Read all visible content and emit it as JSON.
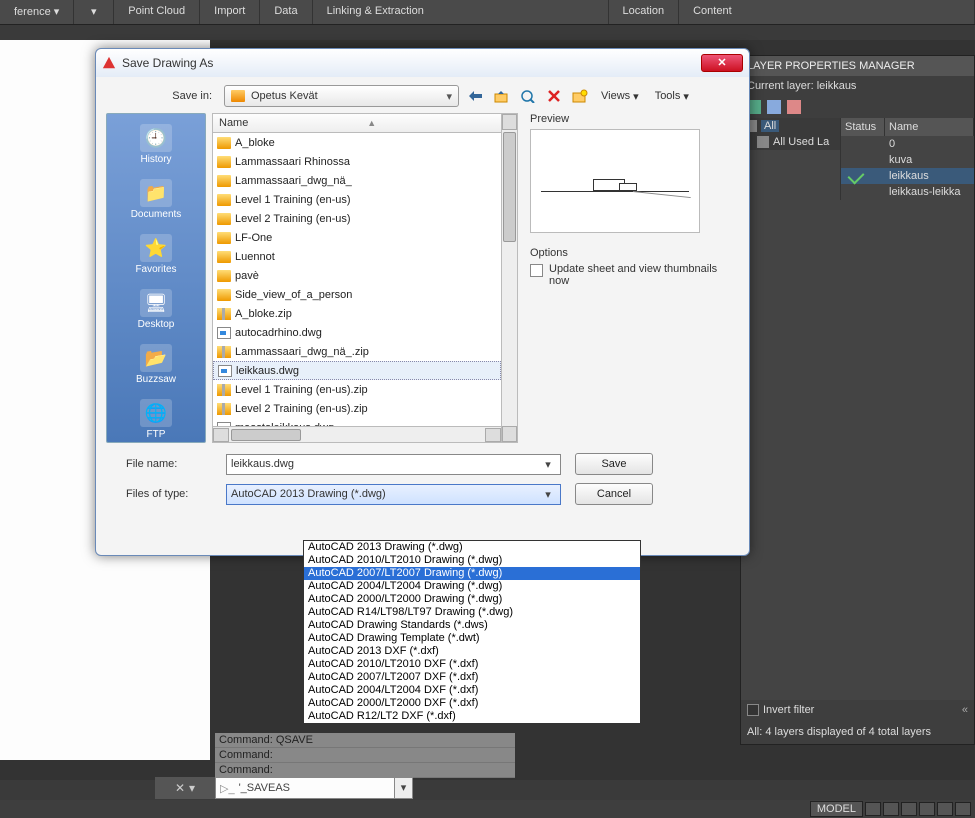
{
  "ribbon": {
    "tabs": [
      "ference ▾",
      "▾",
      "Point Cloud",
      "Import",
      "Data",
      "Linking & Extraction",
      "Location",
      "Content"
    ]
  },
  "layer_panel": {
    "title": "LAYER PROPERTIES MANAGER",
    "current": "Current layer: leikkaus",
    "columns": {
      "status": "Status",
      "name": "Name"
    },
    "filter_all": "All",
    "filter_allused": "All Used La",
    "rows": [
      {
        "name": "0",
        "current": false
      },
      {
        "name": "kuva",
        "current": false
      },
      {
        "name": "leikkaus",
        "current": true
      },
      {
        "name": "leikkaus-leikka",
        "current": false
      }
    ],
    "invert": "Invert filter",
    "status": "All: 4 layers displayed of 4 total layers"
  },
  "command": {
    "hist": [
      "Command:   QSAVE",
      "Command:",
      "Command:"
    ],
    "input": "'_SAVEAS"
  },
  "statusbar": {
    "model": "MODEL"
  },
  "dialog": {
    "title": "Save Drawing As",
    "savein_label": "Save in:",
    "savein_value": "Opetus Kevät",
    "views": "Views",
    "tools": "Tools",
    "places": [
      "History",
      "Documents",
      "Favorites",
      "Desktop",
      "Buzzsaw",
      "FTP"
    ],
    "list_header": "Name",
    "files": [
      {
        "n": "A_bloke",
        "t": "fold"
      },
      {
        "n": "Lammassaari Rhinossa",
        "t": "fold"
      },
      {
        "n": "Lammassaari_dwg_nä_",
        "t": "fold"
      },
      {
        "n": "Level 1 Training (en-us)",
        "t": "fold"
      },
      {
        "n": "Level 2 Training (en-us)",
        "t": "fold"
      },
      {
        "n": "LF-One",
        "t": "fold"
      },
      {
        "n": "Luennot",
        "t": "fold"
      },
      {
        "n": "pavè",
        "t": "fold"
      },
      {
        "n": "Side_view_of_a_person",
        "t": "fold"
      },
      {
        "n": "A_bloke.zip",
        "t": "zip"
      },
      {
        "n": "autocadrhino.dwg",
        "t": "dwg"
      },
      {
        "n": "Lammassaari_dwg_nä_.zip",
        "t": "zip"
      },
      {
        "n": "leikkaus.dwg",
        "t": "dwg",
        "sel": true
      },
      {
        "n": "Level 1 Training (en-us).zip",
        "t": "zip"
      },
      {
        "n": "Level 2 Training (en-us).zip",
        "t": "zip"
      },
      {
        "n": "maastoleikkaus.dwg",
        "t": "dwg"
      }
    ],
    "preview": "Preview",
    "options": "Options",
    "opt_update": "Update sheet and view thumbnails now",
    "filename_label": "File name:",
    "filename": "leikkaus.dwg",
    "filetype_label": "Files of type:",
    "filetype": "AutoCAD 2013 Drawing (*.dwg)",
    "save": "Save",
    "cancel": "Cancel",
    "type_options": [
      "AutoCAD 2013 Drawing (*.dwg)",
      "AutoCAD 2010/LT2010 Drawing (*.dwg)",
      "AutoCAD 2007/LT2007 Drawing (*.dwg)",
      "AutoCAD 2004/LT2004 Drawing (*.dwg)",
      "AutoCAD 2000/LT2000 Drawing (*.dwg)",
      "AutoCAD R14/LT98/LT97 Drawing (*.dwg)",
      "AutoCAD Drawing Standards (*.dws)",
      "AutoCAD Drawing Template (*.dwt)",
      "AutoCAD 2013 DXF (*.dxf)",
      "AutoCAD 2010/LT2010 DXF (*.dxf)",
      "AutoCAD 2007/LT2007 DXF (*.dxf)",
      "AutoCAD 2004/LT2004 DXF (*.dxf)",
      "AutoCAD 2000/LT2000 DXF (*.dxf)",
      "AutoCAD R12/LT2 DXF (*.dxf)"
    ],
    "type_highlight_index": 2
  }
}
